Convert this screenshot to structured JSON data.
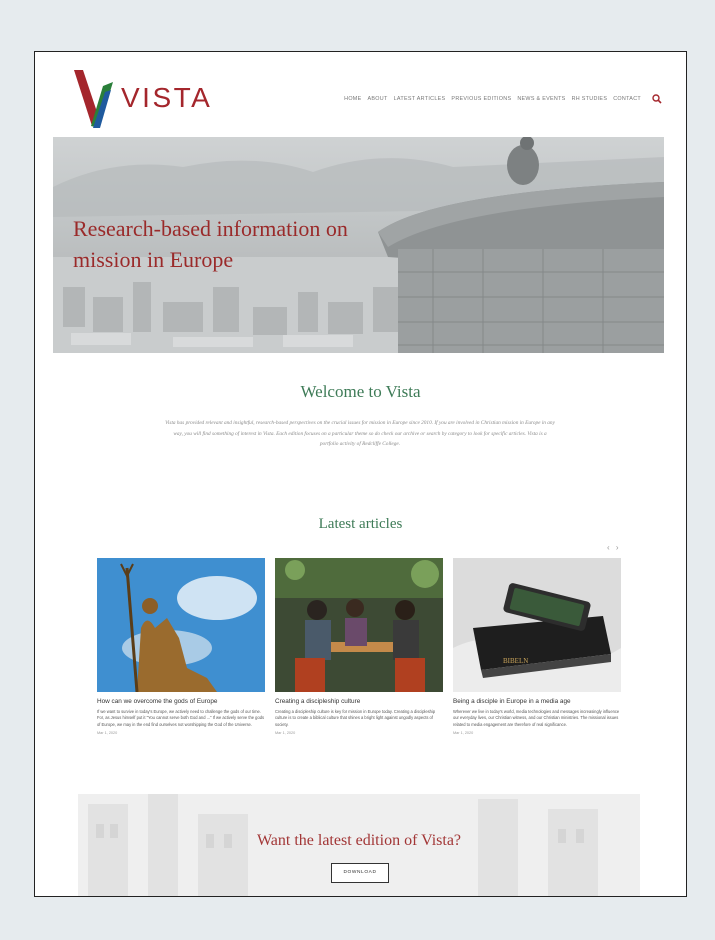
{
  "brand": {
    "name": "VISTA"
  },
  "nav": {
    "items": [
      "HOME",
      "ABOUT",
      "LATEST ARTICLES",
      "PREVIOUS EDITIONS",
      "NEWS & EVENTS",
      "RH STUDIES",
      "CONTACT"
    ],
    "search_icon": "search-icon"
  },
  "hero": {
    "title_line1": "Research-based information on",
    "title_line2": "mission in Europe"
  },
  "welcome": {
    "title": "Welcome to Vista",
    "body": "Vista has provided relevant and insightful, research-based perspectives on the crucial issues for mission in Europe since 2010. If you are involved in Christian mission in Europe in any way, you will find something of interest in Vista. Each edition focuses on a particular theme so do check our archive or search by category to look for specific articles. Vista is a portfolio activity of Redcliffe College."
  },
  "articles": {
    "title": "Latest articles",
    "arrows": "‹ ›",
    "items": [
      {
        "title": "How can we overcome the gods of Europe",
        "text": "If we want to survive in today's Europe, we actively need to challenge the gods of our time. For, as Jesus himself put it \"You cannot serve both God and ...\" If we actively serve the gods of Europe, we may in the end find ourselves not worshipping the God of the Universe.",
        "date": "Mar 1, 2020"
      },
      {
        "title": "Creating a discipleship culture",
        "text": "Creating a discipleship culture is key for mission in Europe today. Creating a discipleship culture is to create a biblical culture that shines a bright light against ungodly aspects of society.",
        "date": "Mar 1, 2020"
      },
      {
        "title": "Being a disciple in Europe in a media age",
        "text": "Wherever we live in today's world, media technologies and messages increasingly influence our everyday lives, our Christian witness, and our Christian ministries. The missional issues related to media engagement are therefore of real significance.",
        "date": "Mar 1, 2020"
      }
    ]
  },
  "cta": {
    "title": "Want the latest edition of Vista?",
    "button": "DOWNLOAD"
  },
  "colors": {
    "brand_red": "#a4262c",
    "heading_green": "#3e7b57",
    "hero_title": "#9a2a2a"
  }
}
